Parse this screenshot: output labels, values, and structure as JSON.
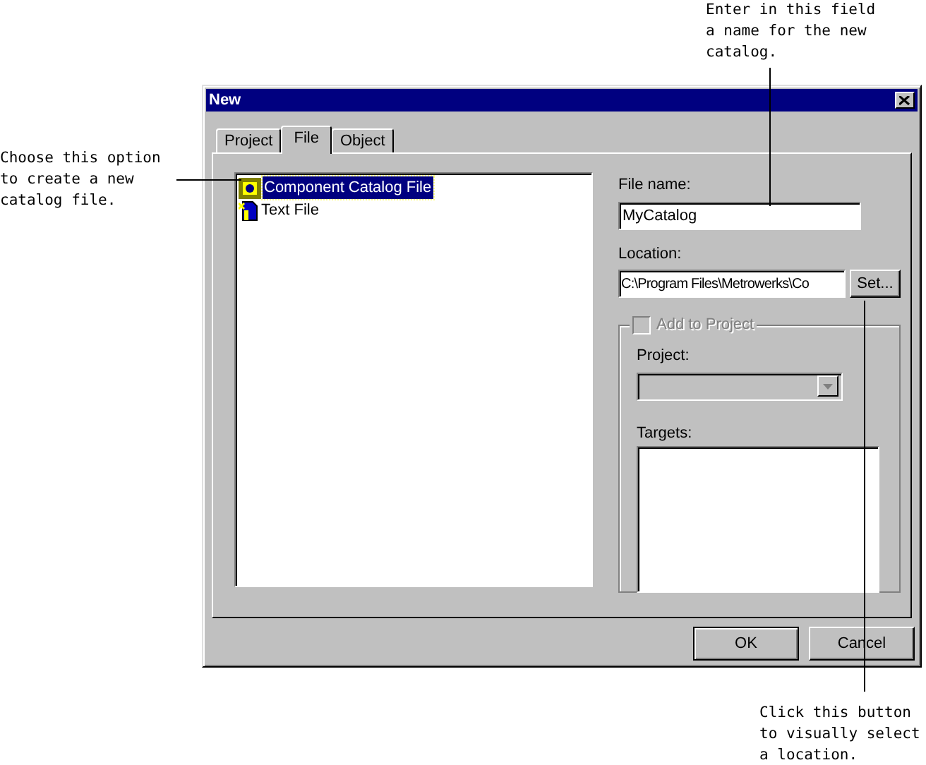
{
  "window": {
    "title": "New"
  },
  "tabs": [
    {
      "label": "Project",
      "selected": false
    },
    {
      "label": "File",
      "selected": true
    },
    {
      "label": "Object",
      "selected": false
    }
  ],
  "file_types": [
    {
      "label": "Component Catalog File",
      "kind": "catalog",
      "selected": true
    },
    {
      "label": "Text File",
      "kind": "text",
      "selected": false
    }
  ],
  "file_name": {
    "label": "File name:",
    "value": "MyCatalog"
  },
  "location": {
    "label": "Location:",
    "value": "C:\\Program Files\\Metrowerks\\Co",
    "button": "Set..."
  },
  "add_to_project": {
    "label": "Add to Project",
    "checked": false,
    "disabled": true,
    "project_label": "Project:",
    "targets_label": "Targets:"
  },
  "buttons": [
    "OK",
    "Cancel"
  ],
  "callouts": [
    {
      "kind": "left",
      "text": "Choose this option to create a new catalog file."
    },
    {
      "kind": "top",
      "text": "Enter in this field a name for the new catalog."
    },
    {
      "kind": "bottom",
      "text": "Click this button to visually select a location."
    }
  ]
}
